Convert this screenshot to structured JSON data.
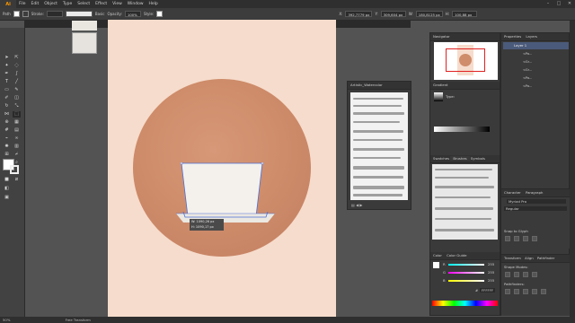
{
  "app": {
    "logo": "Ai"
  },
  "menu": [
    "File",
    "Edit",
    "Object",
    "Type",
    "Select",
    "Effect",
    "View",
    "Window",
    "Help"
  ],
  "window_controls": [
    "–",
    "□",
    "✕"
  ],
  "control_bar": {
    "path_label": "Path",
    "stroke_label": "Stroke:",
    "brush_label": "Basic",
    "opacity_label": "Opacity:",
    "opacity_value": "100%",
    "style_label": "Style:",
    "x_label": "X:",
    "x_value": "392,7779 px",
    "y_label": "Y:",
    "y_value": "309,604 px",
    "w_label": "W:",
    "w_value": "180,8125 px",
    "h_label": "H:",
    "h_value": "100,88 px"
  },
  "measure": {
    "w": "W: 1090,26 px",
    "h": "H: 1090,17 px"
  },
  "brushes_panel": {
    "title": "Artistic_Watercolor"
  },
  "navigator": {
    "tabs": [
      "Navigator",
      "Properties",
      "Layers"
    ]
  },
  "layers": {
    "layer_name": "Layer 1",
    "items": [
      "<Pa...",
      "<Gr...",
      "<Gr...",
      "<Pa...",
      "<Pa..."
    ],
    "count": "1 Layer"
  },
  "gradient": {
    "title": "Gradient",
    "type_label": "Type:"
  },
  "swatches_tabs": [
    "Swatches",
    "Brushes",
    "Symbols"
  ],
  "character": {
    "tabs": [
      "Character",
      "Paragraph"
    ],
    "font": "Myriad Pro",
    "style": "Regular",
    "snap_label": "Snap to Glyph"
  },
  "transform_tabs": [
    "Transform",
    "Align",
    "Pathfinder"
  ],
  "pathfinder": {
    "shape_modes": "Shape Modes:",
    "pathfinders": "Pathfinders:"
  },
  "color": {
    "tabs": [
      "Color",
      "Color Guide"
    ],
    "hex_label": "#",
    "hex_value": "FFFFFF",
    "sliders": [
      {
        "label": "R",
        "value": "255"
      },
      {
        "label": "G",
        "value": "255"
      },
      {
        "label": "B",
        "value": "255"
      }
    ]
  },
  "status": {
    "zoom": "50%",
    "tool": "Free Transform"
  },
  "colors": {
    "artboard": "#f6dccc",
    "circle": "#cf8d6b",
    "cup": "#f4f1ec",
    "selection": "#4a6fd8"
  }
}
